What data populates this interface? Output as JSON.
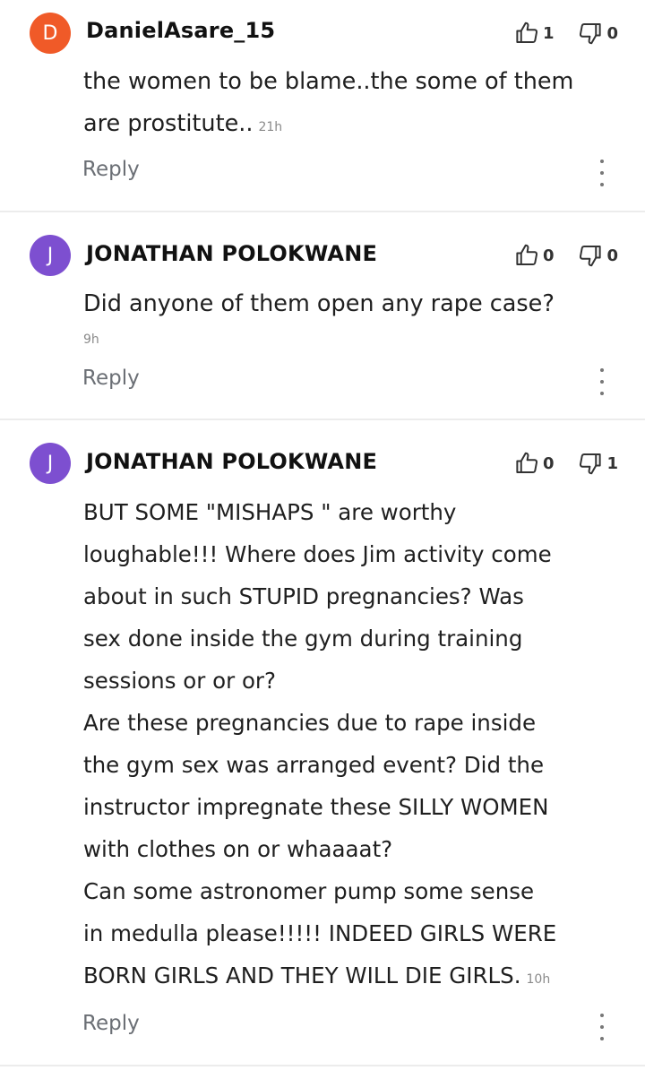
{
  "comments": [
    {
      "initial": "D",
      "avatar_color": "#f05a28",
      "author": "DanielAsare_15",
      "likes": "1",
      "dislikes": "0",
      "text": "the women to be blame..the some of them\nare prostitute..",
      "time": "21h",
      "reply_label": "Reply"
    },
    {
      "initial": "J",
      "avatar_color": "#7d4fd0",
      "author": "JONATHAN POLOKWANE",
      "likes": "0",
      "dislikes": "0",
      "text": "Did anyone of them open any rape case?",
      "time": "9h",
      "reply_label": "Reply"
    },
    {
      "initial": "J",
      "avatar_color": "#7d4fd0",
      "author": "JONATHAN POLOKWANE",
      "likes": "0",
      "dislikes": "1",
      "text": "BUT SOME \"MISHAPS \" are worthy\nloughable!!! Where does Jim activity come\nabout in such STUPID pregnancies? Was\nsex done inside the gym during training\nsessions or or or?\nAre these pregnancies due to rape inside\nthe gym sex was arranged event? Did the\ninstructor  impregnate these SILLY WOMEN\nwith clothes on or whaaaat?\nCan some astronomer pump some sense\nin medulla please!!!!! INDEED GIRLS WERE\nBORN GIRLS AND THEY WILL DIE GIRLS.",
      "time": "10h",
      "reply_label": "Reply"
    }
  ]
}
